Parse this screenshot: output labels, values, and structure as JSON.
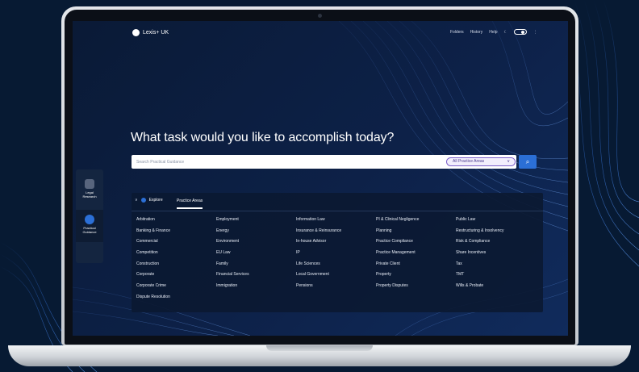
{
  "colors": {
    "page_bg": "#071a33",
    "screen_bg": "#0d2148",
    "accent": "#2b6fd6",
    "select_border": "#7b5fc9",
    "panel_bg": "#0b1932"
  },
  "header": {
    "logo_text": "Lexis+ UK",
    "logo_icon": "lexis-logo-icon",
    "nav": {
      "folders": "Folders",
      "history": "History",
      "help": "Help"
    },
    "toggle_icon": "moon-icon",
    "more_icon": "more-icon"
  },
  "main": {
    "headline": "What task would you like to accomplish today?",
    "search": {
      "placeholder": "Search Practical Guidance",
      "area_value": "All Practice Areas",
      "button_icon": "search-icon"
    }
  },
  "left_rail": {
    "items": [
      {
        "label_1": "Legal",
        "label_2": "Research",
        "icon": "document-icon"
      },
      {
        "label_1": "Practical",
        "label_2": "Guidance",
        "icon": "compass-icon"
      }
    ]
  },
  "explore": {
    "tab_explore": "Explore",
    "tab_practice_areas": "Practice Areas",
    "columns": [
      [
        "Arbitration",
        "Banking & Finance",
        "Commercial",
        "Competition",
        "Construction",
        "Corporate",
        "Corporate Crime",
        "Dispute Resolution"
      ],
      [
        "Employment",
        "Energy",
        "Environment",
        "EU Law",
        "Family",
        "Financial Services",
        "Immigration"
      ],
      [
        "Information Law",
        "Insurance & Reinsurance",
        "In-house Advisor",
        "IP",
        "Life Sciences",
        "Local Government",
        "Pensions"
      ],
      [
        "PI & Clinical Negligence",
        "Planning",
        "Practice Compliance",
        "Practice Management",
        "Private Client",
        "Property",
        "Property Disputes"
      ],
      [
        "Public Law",
        "Restructuring & Insolvency",
        "Risk & Compliance",
        "Share Incentives",
        "Tax",
        "TMT",
        "Wills & Probate"
      ]
    ]
  }
}
